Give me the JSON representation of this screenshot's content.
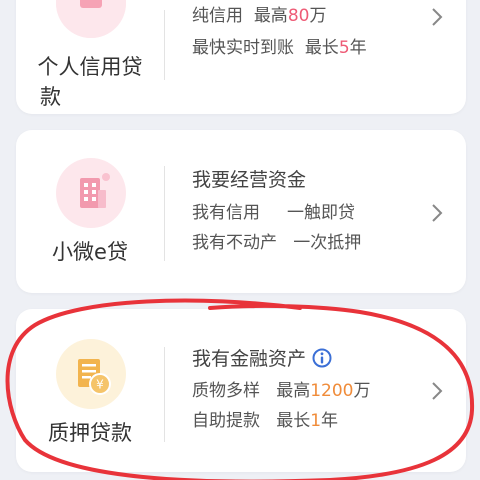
{
  "cards": [
    {
      "title_line1": "个人信用贷",
      "title_line2": "款",
      "line1_a": "纯信用",
      "line1_b": "最高",
      "line1_num": "80",
      "line1_unit": "万",
      "line2_a": "最快实时到账",
      "line2_b": "最长",
      "line2_num": "5",
      "line2_unit": "年",
      "icon": "personal-loan-icon"
    },
    {
      "title": "小微e贷",
      "headline": "我要经营资金",
      "line1_a": "我有信用",
      "line1_b": "一触即贷",
      "line2_a": "我有不动产",
      "line2_b": "一次抵押",
      "icon": "building-icon"
    },
    {
      "title": "质押贷款",
      "headline": "我有金融资产",
      "line1_a": "质物多样",
      "line1_b": "最高",
      "line1_num": "1200",
      "line1_unit": "万",
      "line2_a": "自助提款",
      "line2_b": "最长",
      "line2_num": "1",
      "line2_unit": "年",
      "icon": "document-yen-icon"
    }
  ],
  "colors": {
    "background": "#eef0f5",
    "highlight_orange": "#f08c3a",
    "highlight_pink": "#ee5b76",
    "annotation_red": "#e8333a",
    "info_blue": "#3b6fd6"
  }
}
